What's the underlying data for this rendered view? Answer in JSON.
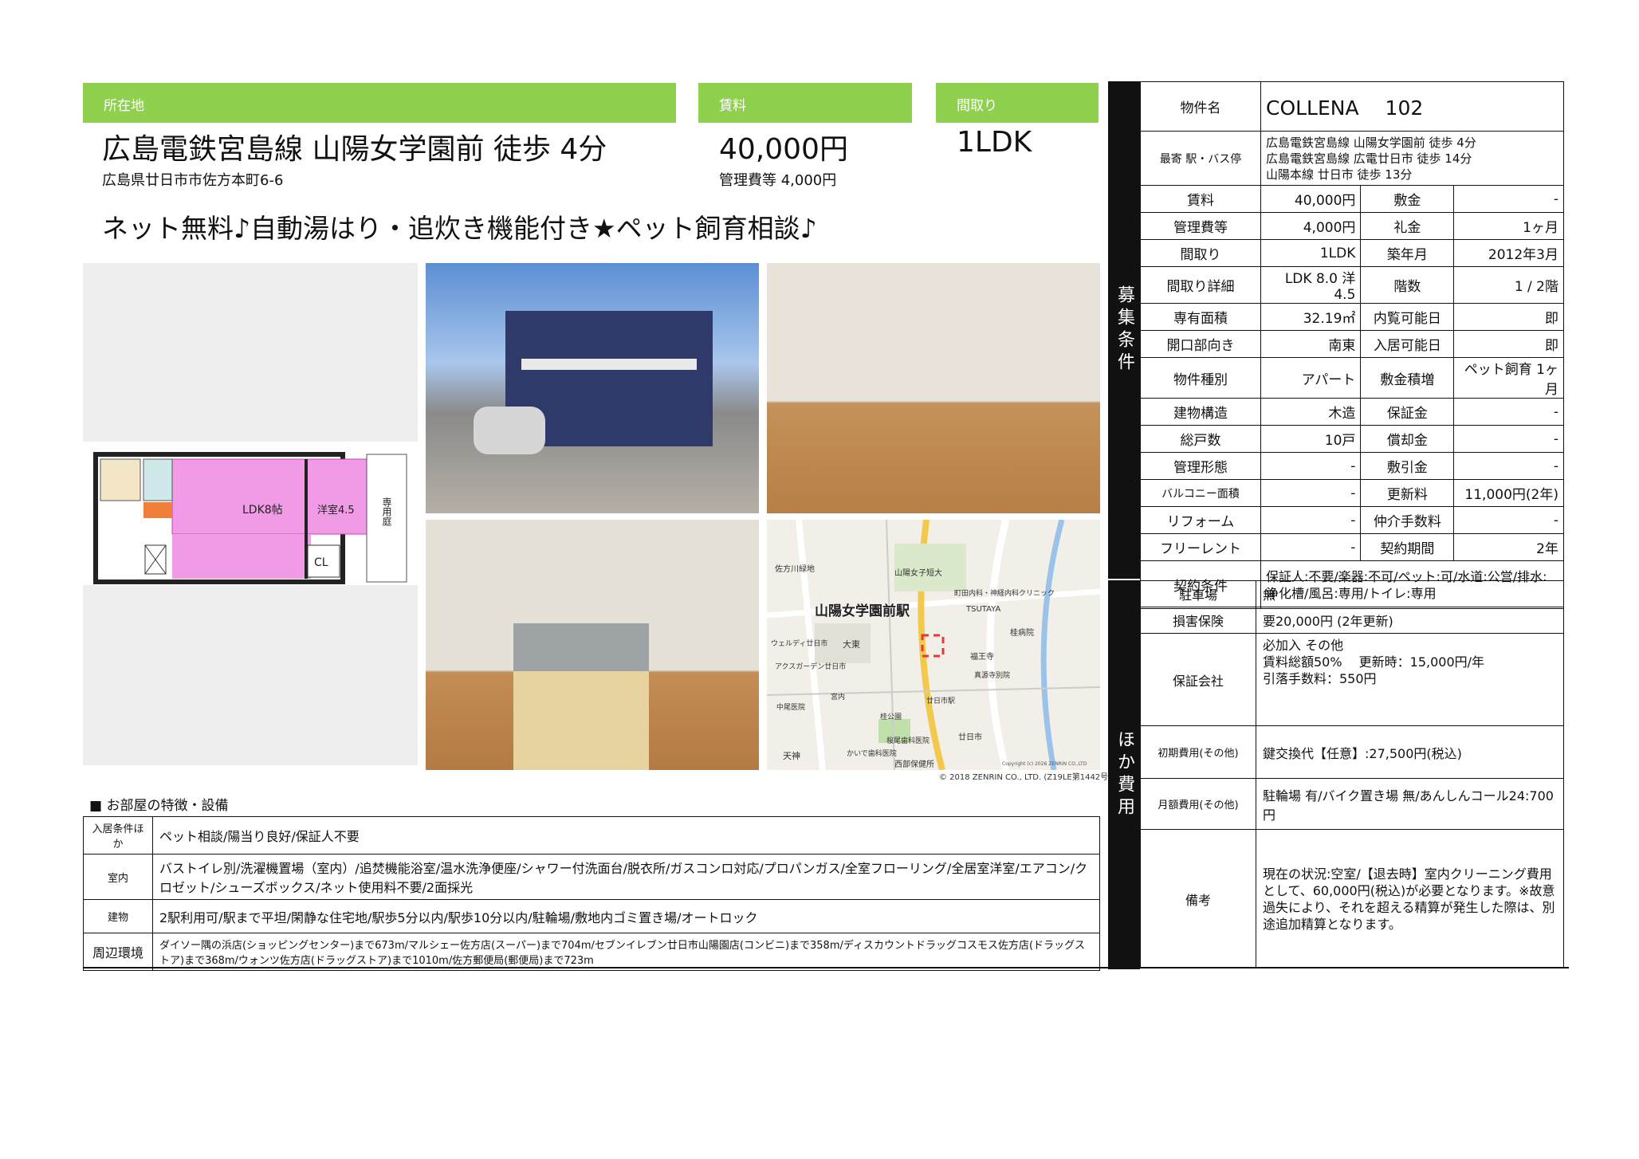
{
  "location": {
    "label": "所在地",
    "station": "広島電鉄宮島線 山陽女学園前 徒歩 4分",
    "address": "広島県廿日市市佐方本町6-6"
  },
  "rent": {
    "label": "賃料",
    "value": "40,000円",
    "fee": "管理費等 4,000円"
  },
  "layout": {
    "label": "間取り",
    "value": "1LDK"
  },
  "catchcopy": "ネット無料♪自動湯はり・追炊き機能付き★ペット飼育相談♪",
  "floorplan": {
    "ldk": "LDK8帖",
    "room": "洋室4.5",
    "cl": "CL",
    "garden": "専用庭"
  },
  "map": {
    "station": "山陽女学園前駅",
    "labels": [
      "佐方川緑地",
      "山陽女子短大",
      "町田内科・神経内科クリニック",
      "TSUTAYA",
      "桂病院",
      "福王寺",
      "真源寺別院",
      "大東",
      "ウェルディ廿日市",
      "アクスガーデン廿日市",
      "中尾医院",
      "宮内",
      "桂公園",
      "桜尾歯科医院",
      "かいで歯科医院",
      "天神",
      "西部保健所",
      "廿日市",
      "廿日市駅"
    ],
    "copyright": "Copyright (c) 2026 ZENRIN CO.,LTD",
    "credit": "© 2018 ZENRIN CO., LTD. (Z19LE第1442号)"
  },
  "features": {
    "title": "■ お部屋の特徴・設備",
    "rows": [
      {
        "head": "入居条件ほか",
        "text": "ペット相談/陽当り良好/保証人不要"
      },
      {
        "head": "室内",
        "text": "バストイレ別/洗濯機置場（室内）/追焚機能浴室/温水洗浄便座/シャワー付洗面台/脱衣所/ガスコンロ対応/プロパンガス/全室フローリング/全居室洋室/エアコン/クロゼット/シューズボックス/ネット使用料不要/2面採光"
      },
      {
        "head": "建物",
        "text": "2駅利用可/駅まで平坦/閑静な住宅地/駅歩5分以内/駅歩10分以内/駐輪場/敷地内ゴミ置き場/オートロック"
      },
      {
        "head": "周辺環境",
        "text": "ダイソー隅の浜店(ショッピングセンター)まで673m/マルシェー佐方店(スーパー)まで704m/セブンイレブン廿日市山陽園店(コンビニ)まで358m/ディスカウントドラッグコスモス佐方店(ドラッグストア)まで368m/ウォンツ佐方店(ドラッグストア)まで1010m/佐方郵便局(郵便局)まで723m"
      }
    ]
  },
  "spec": {
    "side_label": "募集条件",
    "property_name_label": "物件名",
    "property_name": "COLLENA　 102",
    "nearest_label": "最寄 駅・バス停",
    "nearest": [
      "広島電鉄宮島線 山陽女学園前 徒歩 4分",
      "広島電鉄宮島線 広電廿日市 徒歩 14分",
      "山陽本線 廿日市 徒歩 13分"
    ],
    "rows": [
      [
        "賃料",
        "40,000円",
        "敷金",
        "-"
      ],
      [
        "管理費等",
        "4,000円",
        "礼金",
        "1ヶ月"
      ],
      [
        "間取り",
        "1LDK",
        "築年月",
        "2012年3月"
      ],
      [
        "間取り詳細",
        "LDK 8.0 洋4.5",
        "階数",
        "1 / 2階"
      ],
      [
        "専有面積",
        "32.19㎡",
        "内覧可能日",
        "即"
      ],
      [
        "開口部向き",
        "南東",
        "入居可能日",
        "即"
      ],
      [
        "物件種別",
        "アパート",
        "敷金積増",
        "ペット飼育 1ヶ月"
      ],
      [
        "建物構造",
        "木造",
        "保証金",
        "-"
      ],
      [
        "総戸数",
        "10戸",
        "償却金",
        "-"
      ],
      [
        "管理形態",
        "-",
        "敷引金",
        "-"
      ],
      [
        "バルコニー面積",
        "-",
        "更新料",
        "11,000円(2年)"
      ],
      [
        "リフォーム",
        "-",
        "仲介手数料",
        "-"
      ],
      [
        "フリーレント",
        "-",
        "契約期間",
        "2年"
      ]
    ],
    "contract_label": "契約条件",
    "contract": "保証人:不要/楽器:不可/ペット:可/水道:公営/排水:浄化槽/風呂:専用/トイレ:専用"
  },
  "other": {
    "side_label": "ほか費用",
    "rows": [
      {
        "head": "駐車場",
        "text": "無"
      },
      {
        "head": "損害保険",
        "text": "要20,000円 (2年更新)"
      },
      {
        "head": "保証会社",
        "text": "必加入 その他\n賃料総額50%　 更新時：15,000円/年\n引落手数料：550円"
      },
      {
        "head": "初期費用(その他)",
        "text": "鍵交換代【任意】:27,500円(税込)"
      },
      {
        "head": "月額費用(その他)",
        "text": "駐輪場 有/バイク置き場 無/あんしんコール24:700円"
      },
      {
        "head": "備考",
        "text": "現在の状況:空室/【退去時】室内クリーニング費用として、60,000円(税込)が必要となります。※故意過失により、それを超える精算が発生した際は、別途追加精算となります。"
      }
    ]
  },
  "colors": {
    "accent": "#8fd14f",
    "dark": "#111111",
    "ldk_fill": "#f19be6"
  }
}
